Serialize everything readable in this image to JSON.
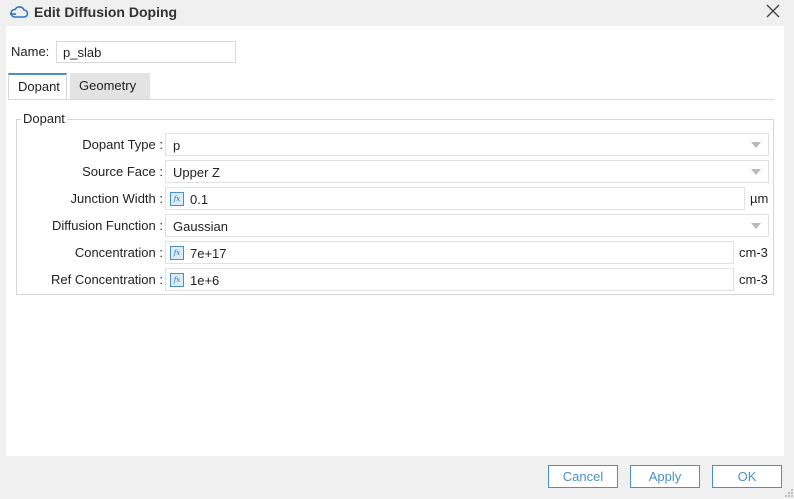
{
  "window": {
    "title": "Edit Diffusion Doping",
    "title_icon": "cloud-icon",
    "close_icon": "close-icon"
  },
  "name_field": {
    "label": "Name:",
    "value": "p_slab"
  },
  "tabs": [
    {
      "label": "Dopant",
      "active": true
    },
    {
      "label": "Geometry",
      "active": false
    }
  ],
  "group": {
    "title": "Dopant"
  },
  "fields": {
    "dopant_type": {
      "label": "Dopant Type :",
      "value": "p"
    },
    "source_face": {
      "label": "Source Face :",
      "value": "Upper Z"
    },
    "junction_width": {
      "label": "Junction Width :",
      "value": "0.1",
      "unit": "µm",
      "icon": "function-icon"
    },
    "diffusion_function": {
      "label": "Diffusion Function :",
      "value": "Gaussian"
    },
    "concentration": {
      "label": "Concentration :",
      "value": "7e+17",
      "unit": "cm-3",
      "icon": "function-icon"
    },
    "ref_concentration": {
      "label": "Ref Concentration :",
      "value": "1e+6",
      "unit": "cm-3",
      "icon": "function-icon"
    }
  },
  "buttons": {
    "cancel": "Cancel",
    "apply": "Apply",
    "ok": "OK"
  },
  "colors": {
    "accent": "#4a90c8",
    "background": "#f0f0f0",
    "panel": "#ffffff"
  }
}
